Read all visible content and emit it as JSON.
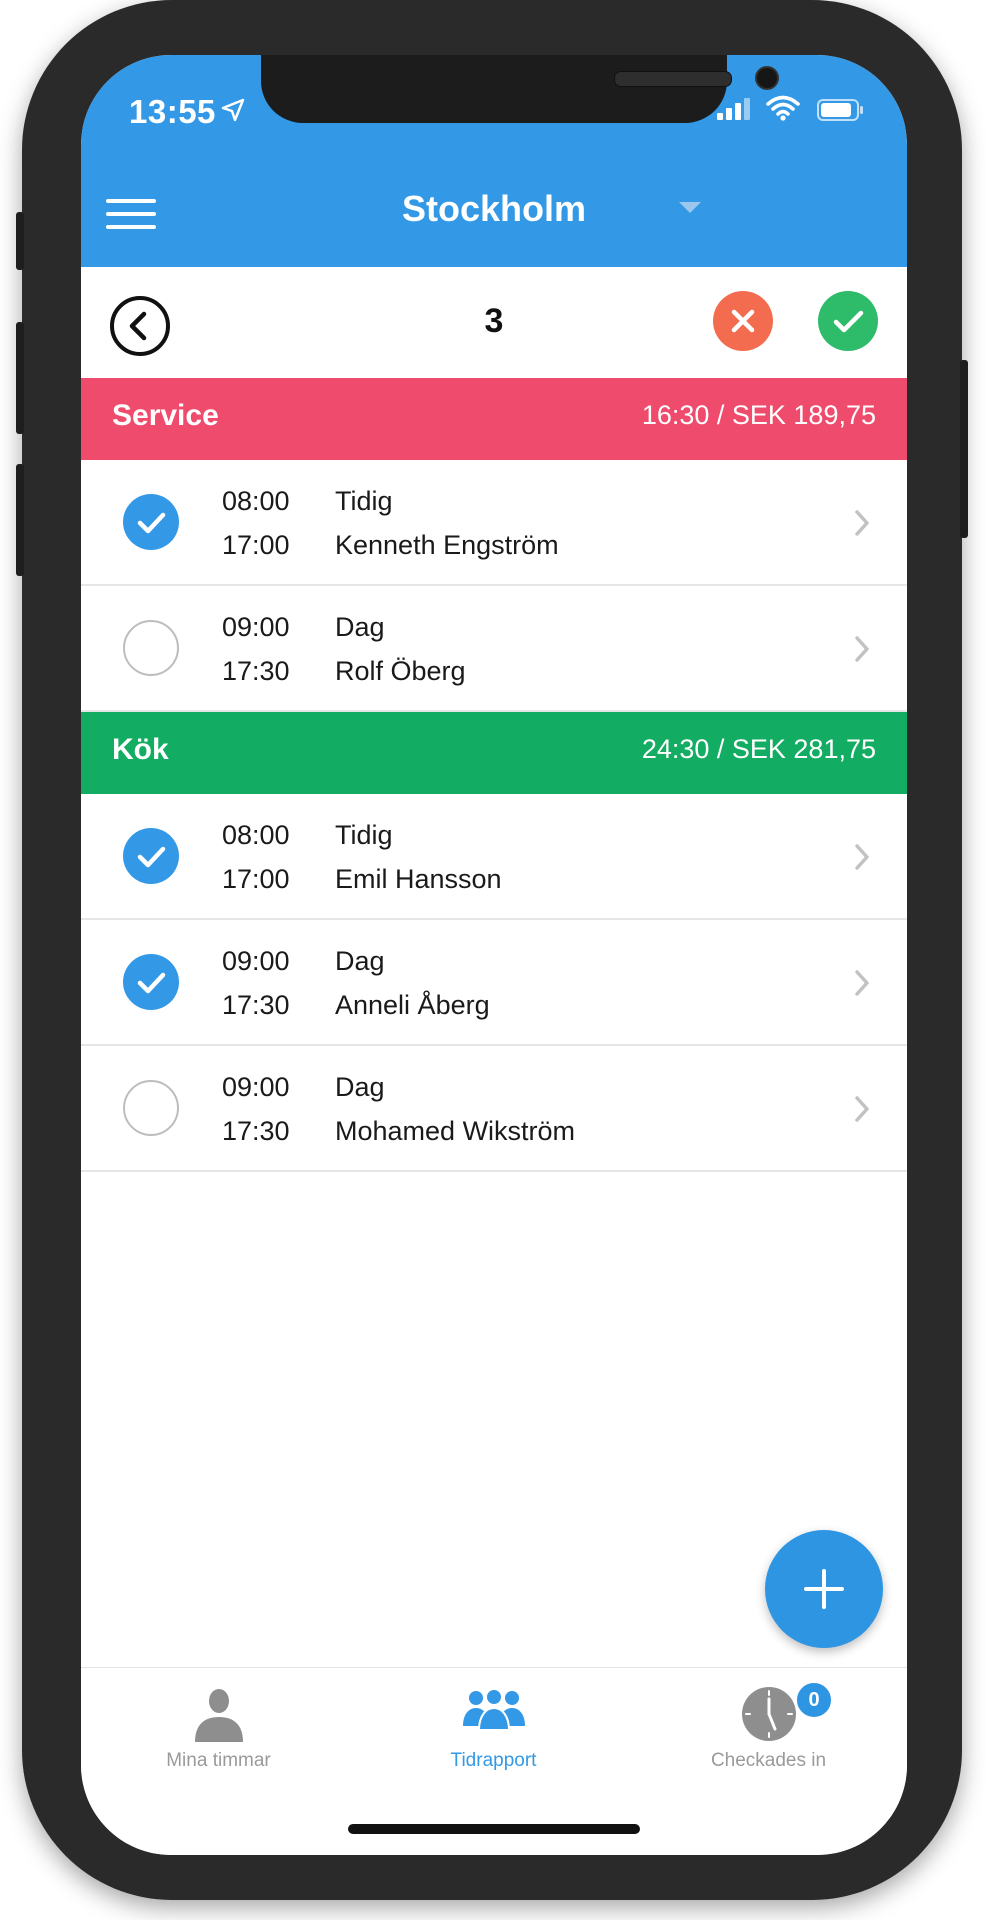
{
  "status_bar": {
    "time": "13:55"
  },
  "header": {
    "title": "Stockholm"
  },
  "toolbar": {
    "count": "3"
  },
  "sections": [
    {
      "name": "Service",
      "total": "16:30 / SEK 189,75",
      "color": "#ef4b6c",
      "rows": [
        {
          "start": "08:00",
          "end": "17:00",
          "shift": "Tidig",
          "person": "Kenneth Engström",
          "checked": true
        },
        {
          "start": "09:00",
          "end": "17:30",
          "shift": "Dag",
          "person": "Rolf Öberg",
          "checked": false
        }
      ]
    },
    {
      "name": "Kök",
      "total": "24:30 / SEK 281,75",
      "color": "#12ad62",
      "rows": [
        {
          "start": "08:00",
          "end": "17:00",
          "shift": "Tidig",
          "person": "Emil Hansson",
          "checked": true
        },
        {
          "start": "09:00",
          "end": "17:30",
          "shift": "Dag",
          "person": "Anneli Åberg",
          "checked": true
        },
        {
          "start": "09:00",
          "end": "17:30",
          "shift": "Dag",
          "person": "Mohamed Wikström",
          "checked": false
        }
      ]
    }
  ],
  "tabs": [
    {
      "label": "Mina timmar",
      "icon": "person-icon",
      "active": false
    },
    {
      "label": "Tidrapport",
      "icon": "group-icon",
      "active": true
    },
    {
      "label": "Checkades in",
      "icon": "clock-icon",
      "active": false,
      "badge": "0"
    }
  ],
  "colors": {
    "accent": "#3399e6",
    "reject": "#f36c4f",
    "approve": "#2fbc6a"
  }
}
